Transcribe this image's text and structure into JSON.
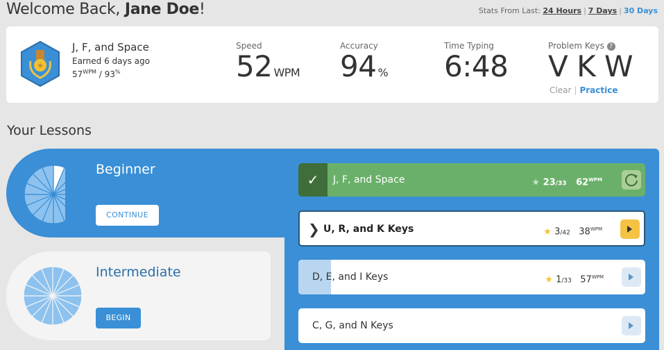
{
  "header": {
    "welcome_prefix": "Welcome Back, ",
    "user_name": "Jane Doe",
    "welcome_suffix": "!",
    "stats_from_label": "Stats From Last:",
    "ranges": [
      "24 Hours",
      "7 Days",
      "30 Days"
    ],
    "active_range": "30 Days"
  },
  "badge": {
    "title": "J, F, and Space",
    "earned": "Earned 6 days ago",
    "wpm_value": "57",
    "wpm_unit": "WPM",
    "separator": " / ",
    "accuracy_value": "93",
    "accuracy_unit": "%",
    "icon": "medal-badge-icon",
    "color": "#3a8fd6"
  },
  "stats": {
    "speed": {
      "label": "Speed",
      "value": "52",
      "unit": "WPM"
    },
    "accuracy": {
      "label": "Accuracy",
      "value": "94",
      "unit": "%"
    },
    "time": {
      "label": "Time Typing",
      "value": "6:48"
    },
    "problem_keys": {
      "label": "Problem Keys",
      "keys": "V K W",
      "help": "?",
      "clear": "Clear",
      "practice": "Practice"
    }
  },
  "lessons_heading": "Your Lessons",
  "levels": {
    "beginner": {
      "title": "Beginner",
      "button": "CONTINUE",
      "progress_fraction": 0.0625
    },
    "intermediate": {
      "title": "Intermediate",
      "button": "BEGIN",
      "progress_fraction": 0
    }
  },
  "lessons": [
    {
      "name": "J, F, and Space",
      "stars": "23",
      "stars_total": "/33",
      "wpm": "62",
      "wpm_unit": "WPM",
      "status": "completed",
      "action_icon": "replay-icon"
    },
    {
      "name": "U, R, and K Keys",
      "stars": "3",
      "stars_total": "/42",
      "wpm": "38",
      "wpm_unit": "WPM",
      "status": "current",
      "action_icon": "play-icon"
    },
    {
      "name": "D, E, and I Keys",
      "stars": "1",
      "stars_total": "/33",
      "wpm": "57",
      "wpm_unit": "WPM",
      "status": "in-progress",
      "progress_fraction": 0.1,
      "action_icon": "play-icon"
    },
    {
      "name": "C, G, and N Keys",
      "status": "not-started",
      "action_icon": "play-icon"
    }
  ],
  "colors": {
    "accent": "#3a8fd6",
    "completed": "#6ab06a",
    "star": "#f2c230",
    "current_action": "#f6c243"
  }
}
